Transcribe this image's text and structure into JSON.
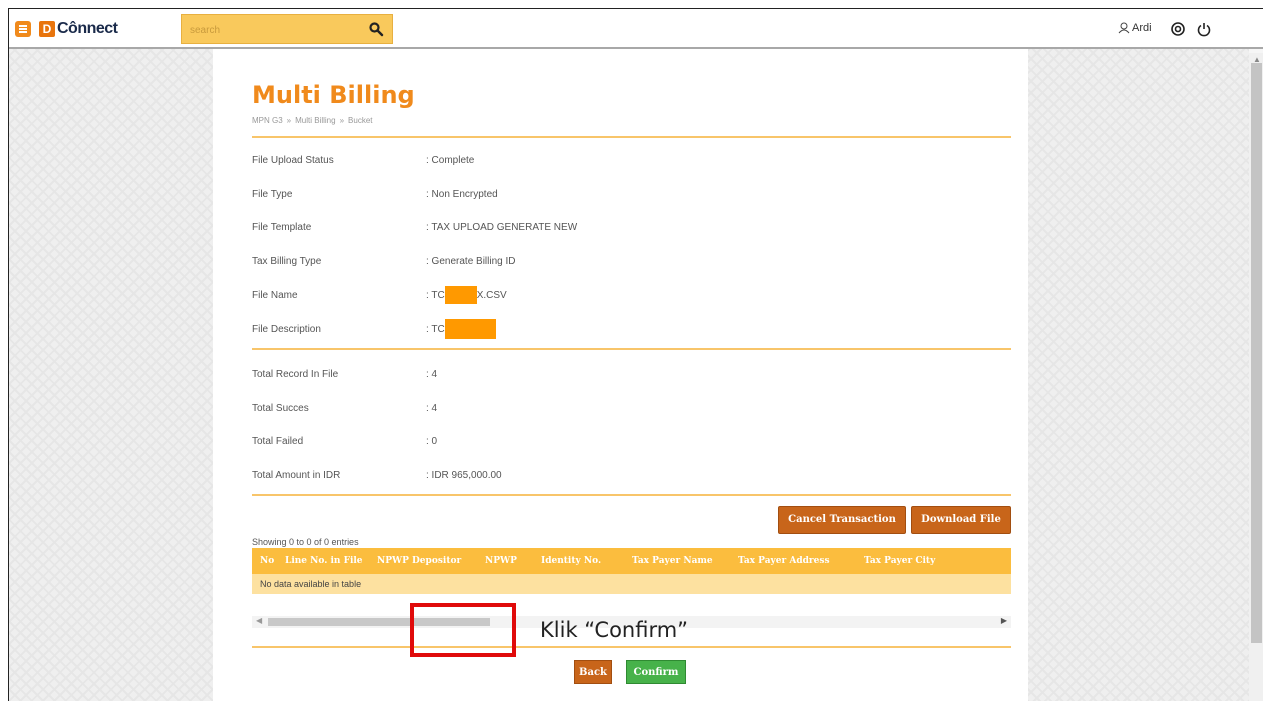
{
  "header": {
    "logo_letter": "D",
    "logo_text": "Cônnect",
    "search_placeholder": "search",
    "user_name": "Ardi",
    "icons": [
      "menu-icon",
      "search-icon",
      "user-icon",
      "help-icon",
      "power-icon"
    ]
  },
  "page": {
    "title": "Multi Billing",
    "breadcrumb": [
      "MPN G3",
      "»",
      "Multi Billing",
      "»",
      "Bucket"
    ]
  },
  "details": [
    {
      "label": "File Upload Status",
      "value": ": Complete"
    },
    {
      "label": "File Type",
      "value": ": Non Encrypted"
    },
    {
      "label": "File Template",
      "value": ": TAX UPLOAD GENERATE NEW"
    },
    {
      "label": "Tax Billing Type",
      "value": ": Generate Billing ID"
    },
    {
      "label": "File Name",
      "value_prefix": ": TC",
      "value_suffix": "X.CSV"
    },
    {
      "label": "File Description",
      "value_prefix": ": TC"
    }
  ],
  "totals": [
    {
      "label": "Total Record In File",
      "value": ": 4"
    },
    {
      "label": "Total Succes",
      "value": ": 4"
    },
    {
      "label": "Total Failed",
      "value": ": 0"
    },
    {
      "label": "Total Amount in IDR",
      "value": ": IDR  965,000.00"
    }
  ],
  "actions": {
    "cancel": "Cancel Transaction",
    "download": "Download File"
  },
  "table": {
    "showing": "Showing 0 to 0 of 0 entries",
    "columns": [
      "No",
      "Line No. in File",
      "NPWP Depositor",
      "NPWP",
      "Identity No.",
      "Tax Payer Name",
      "Tax Payer Address",
      "Tax Payer City"
    ],
    "empty_text": "No data available in table"
  },
  "footer": {
    "back": "Back",
    "confirm": "Confirm",
    "annotation": "Klik “Confirm”"
  },
  "colors": {
    "accent": "#f08a1c",
    "table_header": "#fbbd3e",
    "confirm": "#47b24a",
    "highlight": "#e00a0a"
  }
}
